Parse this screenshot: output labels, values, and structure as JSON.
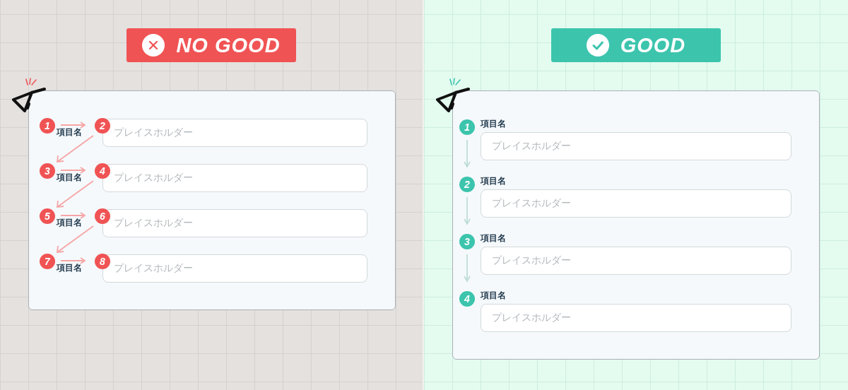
{
  "panels": [
    {
      "kind": "bad",
      "badge": "NO GOOD",
      "fields": [
        {
          "label_step": "1",
          "label": "項目名",
          "field_step": "2",
          "placeholder": "プレイスホルダー"
        },
        {
          "label_step": "3",
          "label": "項目名",
          "field_step": "4",
          "placeholder": "プレイスホルダー"
        },
        {
          "label_step": "5",
          "label": "項目名",
          "field_step": "6",
          "placeholder": "プレイスホルダー"
        },
        {
          "label_step": "7",
          "label": "項目名",
          "field_step": "8",
          "placeholder": "プレイスホルダー"
        }
      ]
    },
    {
      "kind": "good",
      "badge": "GOOD",
      "fields": [
        {
          "step": "1",
          "label": "項目名",
          "placeholder": "プレイスホルダー"
        },
        {
          "step": "2",
          "label": "項目名",
          "placeholder": "プレイスホルダー"
        },
        {
          "step": "3",
          "label": "項目名",
          "placeholder": "プレイスホルダー"
        },
        {
          "step": "4",
          "label": "項目名",
          "placeholder": "プレイスホルダー"
        }
      ]
    }
  ]
}
